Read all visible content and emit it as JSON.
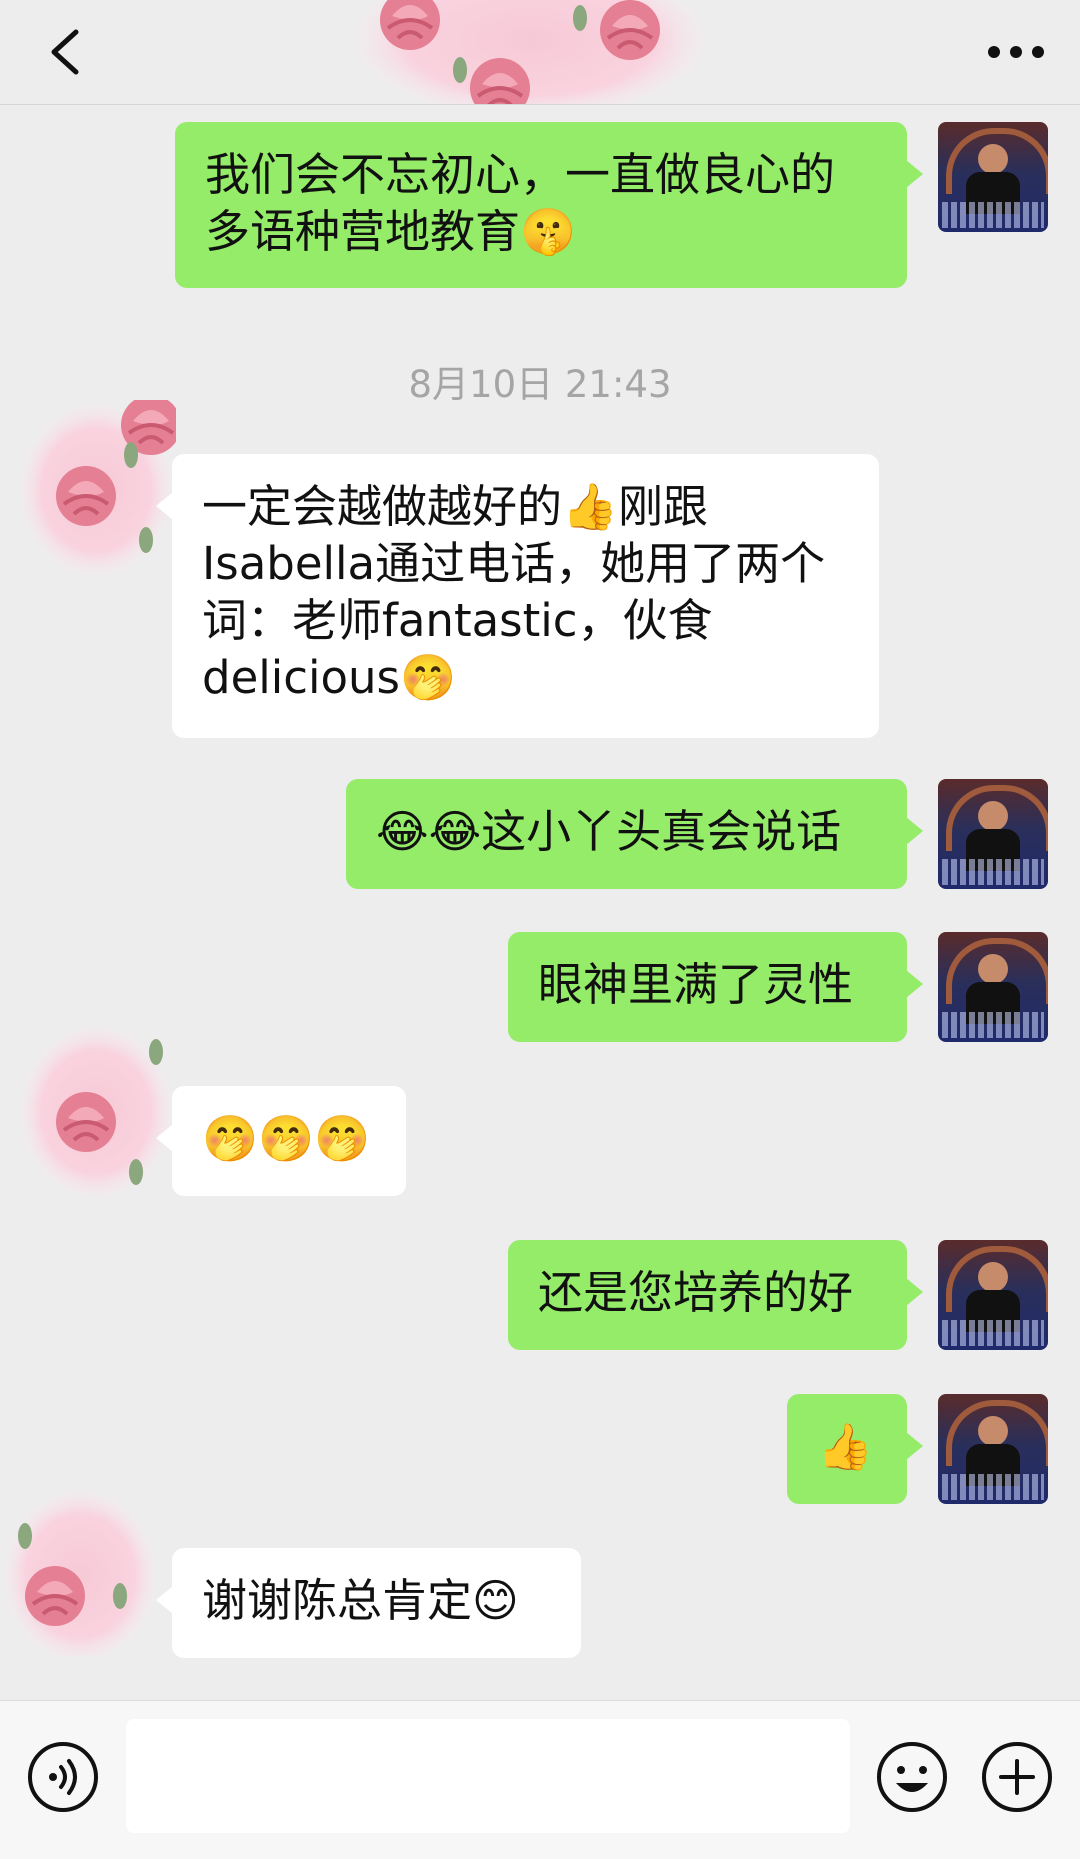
{
  "header": {
    "back_icon": "chevron-left-icon",
    "more_icon": "ellipsis-icon"
  },
  "messages": [
    {
      "id": 1,
      "sender": "me",
      "text": "我们会不忘初心，一直做良心的多语种营地教育🤫"
    },
    {
      "id": 2,
      "type": "timestamp",
      "text": "8月10日 21:43"
    },
    {
      "id": 3,
      "sender": "them",
      "text": "一定会越做越好的👍刚跟Isabella通过电话，她用了两个词：老师fantastic，伙食delicious🤭"
    },
    {
      "id": 4,
      "sender": "me",
      "text": "😂😂这小丫头真会说话"
    },
    {
      "id": 5,
      "sender": "me",
      "text": "眼神里满了灵性"
    },
    {
      "id": 6,
      "sender": "them",
      "text": "🤭🤭🤭"
    },
    {
      "id": 7,
      "sender": "me",
      "text": "还是您培养的好"
    },
    {
      "id": 8,
      "sender": "me",
      "text": "👍"
    },
    {
      "id": 9,
      "sender": "them",
      "text": "谢谢陈总肯定😊"
    }
  ],
  "input": {
    "placeholder": "",
    "value": ""
  },
  "toolbar": {
    "voice_icon": "voice-icon",
    "emoji_icon": "emoji-icon",
    "plus_icon": "plus-icon"
  },
  "colors": {
    "my_bubble": "#95ec69",
    "their_bubble": "#ffffff",
    "background": "#ededed"
  }
}
